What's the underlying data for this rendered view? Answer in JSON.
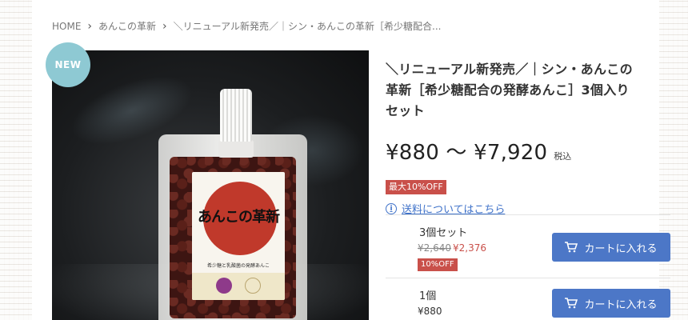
{
  "breadcrumb": {
    "home": "HOME",
    "category": "あんこの革新",
    "current": "＼リニューアル新発売／｜シン・あんこの革新［希少糖配合..."
  },
  "product_image": {
    "badge": "NEW",
    "label_title": "あんこの革新",
    "label_sub": "希少糖と乳酸菌の発酵あんこ"
  },
  "product": {
    "title": "＼リニューアル新発売／｜シン・あんこの革新［希少糖配合の発酵あんこ］3個入りセット",
    "price_range": "¥880 〜 ¥7,920",
    "tax_label": "税込",
    "max_discount": "最大10%OFF",
    "shipping_link": "送料についてはこちら",
    "info_icon": "i"
  },
  "variants": [
    {
      "name": "3個セット",
      "old_price": "¥2,640",
      "new_price": "¥2,376",
      "discount": "10%OFF",
      "cart_label": "カートに入れる"
    },
    {
      "name": "1個",
      "price": "¥880",
      "cart_label": "カートに入れる"
    }
  ],
  "colors": {
    "accent_blue": "#4c77c7",
    "sale_red": "#c9504a",
    "new_badge": "#8ec9d3"
  }
}
